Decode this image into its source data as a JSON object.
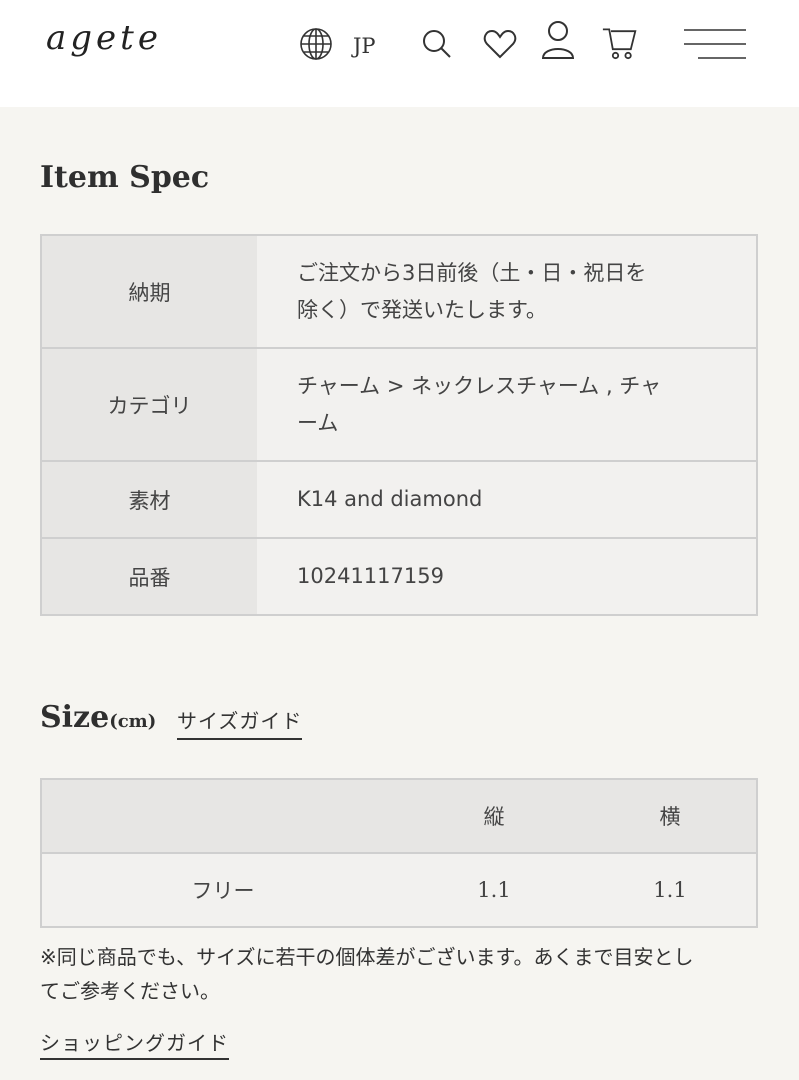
{
  "header": {
    "logo": "agete",
    "language": "JP",
    "icons": [
      "globe-icon",
      "search-icon",
      "heart-icon",
      "user-icon",
      "cart-icon",
      "menu-icon"
    ]
  },
  "item_spec": {
    "title": "Item Spec",
    "rows": [
      {
        "key": "納期",
        "lines": [
          "ご注文から3日前後（土・日・祝日を",
          "除く）で発送いたします。"
        ]
      },
      {
        "key": "カテゴリ",
        "lines": [
          "チャーム > ネックレスチャーム , チャ",
          "ーム"
        ]
      },
      {
        "key": "素材",
        "lines": [
          "K14 and diamond"
        ]
      },
      {
        "key": "品番",
        "lines": [
          "10241117159"
        ]
      }
    ]
  },
  "size": {
    "title": "Size",
    "unit": "(cm)",
    "guide_link": "サイズガイド",
    "headers": [
      "",
      "縦",
      "横"
    ],
    "rows": [
      [
        "フリー",
        "1.1",
        "1.1"
      ]
    ],
    "note_lines": [
      "※同じ商品でも、サイズに若干の個体差がございます。あくまで目安とし",
      "てご参考ください。"
    ],
    "shopping_guide": "ショッピングガイド"
  },
  "colors": {
    "background": "#f6f5f1",
    "header": "#ffffff",
    "key_cell": "#e7e6e4",
    "value_cell": "#f2f1ef",
    "border": "#cfcfcf"
  }
}
